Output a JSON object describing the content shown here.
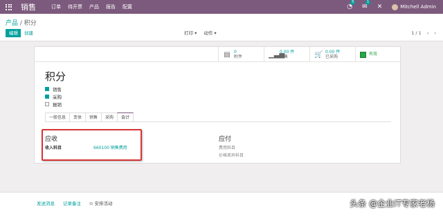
{
  "nav": {
    "brand": "销售",
    "menu": [
      "订单",
      "待开票",
      "产品",
      "报告",
      "配置"
    ],
    "activity_count": "5",
    "message_count": "1",
    "user": "Mitchell Admin"
  },
  "breadcrumb": {
    "parent": "产品",
    "separator": " / ",
    "current": "积分"
  },
  "buttons": {
    "edit": "编辑",
    "create": "创建"
  },
  "toolbar": {
    "print": "打印 ▾",
    "action": "动作 ▾"
  },
  "pager": {
    "value": "1 / 1",
    "prev": "‹",
    "next": "›"
  },
  "stat_buttons": [
    {
      "icon": "file-icon",
      "value": "0",
      "label": "附件"
    },
    {
      "icon": "chart-icon",
      "value": "0.00 件",
      "label": "已售"
    },
    {
      "icon": "cart-icon",
      "value": "0.00 件",
      "label": "已采购"
    },
    {
      "icon": "active-toggle-icon",
      "value": "有效",
      "label": ""
    }
  ],
  "product": {
    "name": "积分",
    "options": [
      {
        "label": "销售",
        "checked": true
      },
      {
        "label": "采购",
        "checked": true
      },
      {
        "label": "报销",
        "checked": false
      }
    ]
  },
  "tabs": [
    "一般信息",
    "变体",
    "销售",
    "采购",
    "会计"
  ],
  "accounting": {
    "receivable": {
      "title": "应收",
      "field": "收入科目",
      "value": "660100 销售费用"
    },
    "payable": {
      "title": "应付",
      "field1": "费用科目",
      "field2": "价格差异科目"
    }
  },
  "chatter": {
    "send": "发送消息",
    "log": "记录备注",
    "schedule": "⊙ 安排活动"
  },
  "watermark": "头条 @企业IT专家老杨"
}
